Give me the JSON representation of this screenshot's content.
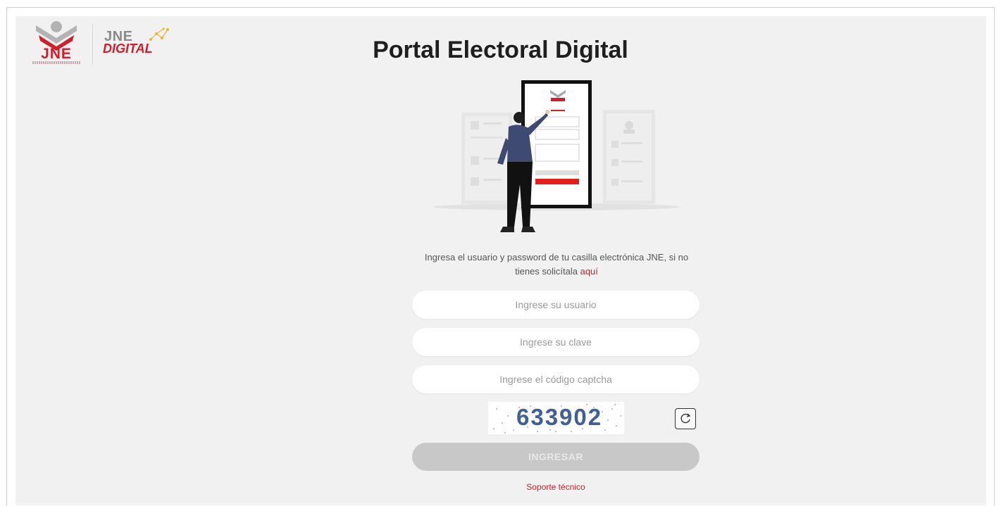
{
  "brand": {
    "logo_text": "JNE",
    "digital_top": "JNE",
    "digital_bottom": "DIGITAL"
  },
  "title": "Portal Electoral Digital",
  "instructions": {
    "text": "Ingresa el usuario y password de tu casilla electrónica JNE, si no tienes solicítala ",
    "link": "aquí"
  },
  "form": {
    "username_placeholder": "Ingrese su usuario",
    "password_placeholder": "Ingrese su clave",
    "captcha_placeholder": "Ingrese el código captcha",
    "captcha_value": "633902",
    "submit_label": "INGRESAR"
  },
  "footer": {
    "support_link": "Soporte técnico"
  },
  "icons": {
    "refresh": "refresh-icon",
    "illustration": "login-illustration"
  },
  "colors": {
    "accent": "#d01f2a",
    "background": "#f1f1f1",
    "button_disabled": "#c8c8c8",
    "captcha_text": "#3f5f95"
  }
}
